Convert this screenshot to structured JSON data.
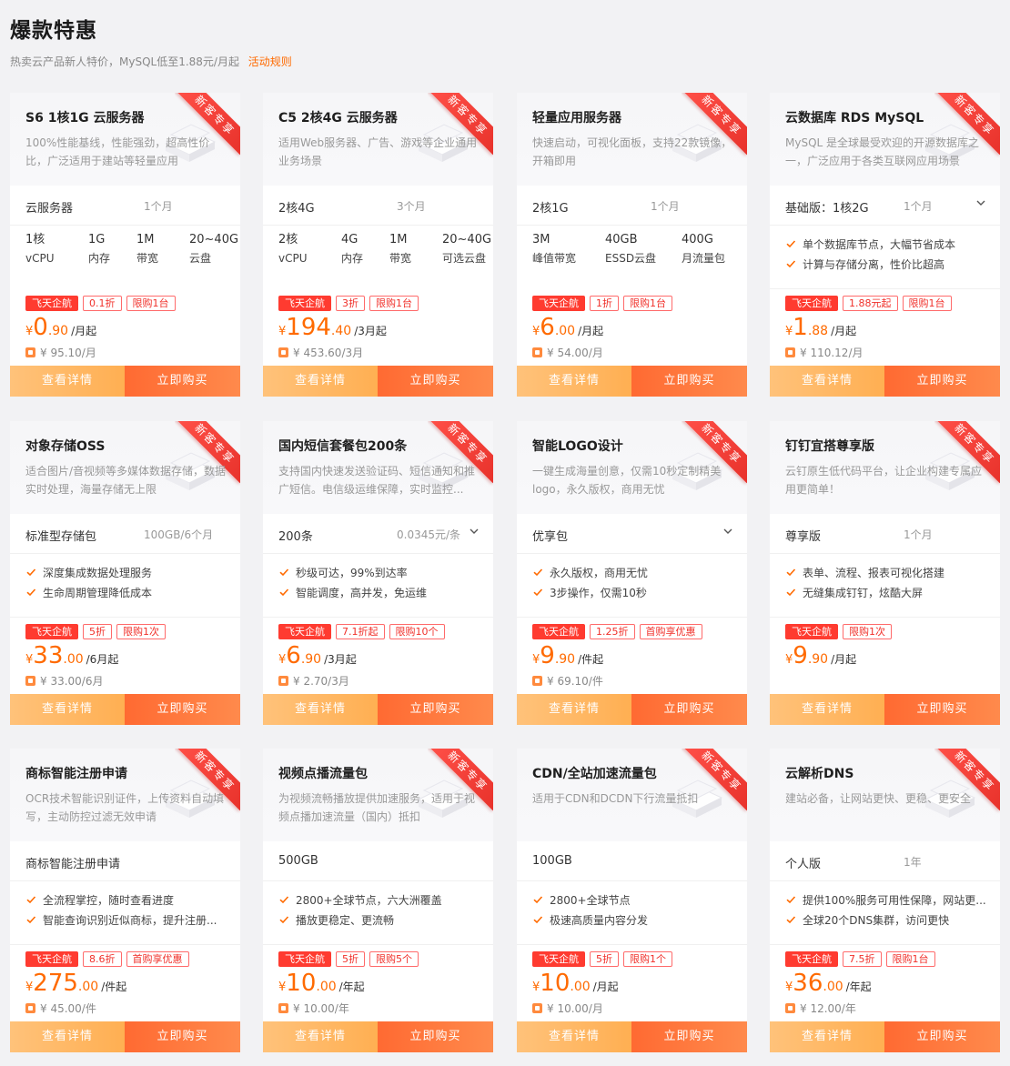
{
  "page": {
    "title": "爆款特惠",
    "subtitle": "热卖云产品新人特价，MySQL低至1.88元/月起",
    "rule_link": "活动规则"
  },
  "common": {
    "ribbon": "新客专享",
    "detail_btn": "查看详情",
    "buy_btn": "立即购买",
    "promo_tag": "飞天企航"
  },
  "cards": [
    {
      "title": "S6 1核1G 云服务器",
      "desc": "100%性能基线，性能强劲，超高性价比，广泛适用于建站等轻量应用",
      "spec": "云服务器",
      "duration": "1个月",
      "has_dropdown": false,
      "params": [
        {
          "v": "1核",
          "l": "vCPU"
        },
        {
          "v": "1G",
          "l": "内存"
        },
        {
          "v": "1M",
          "l": "带宽"
        },
        {
          "v": "20~40G",
          "l": "云盘"
        }
      ],
      "features": [],
      "tags": [
        "0.1折",
        "限购1台"
      ],
      "price_cur": "¥",
      "price_int": "0",
      "price_dec": ".90",
      "price_unit": "/月起",
      "orig": "¥ 95.10/月"
    },
    {
      "title": "C5 2核4G 云服务器",
      "desc": "适用Web服务器、广告、游戏等企业通用业务场景",
      "spec": "2核4G",
      "duration": "3个月",
      "has_dropdown": false,
      "params": [
        {
          "v": "2核",
          "l": "vCPU"
        },
        {
          "v": "4G",
          "l": "内存"
        },
        {
          "v": "1M",
          "l": "带宽"
        },
        {
          "v": "20~40G",
          "l": "可选云盘"
        }
      ],
      "features": [],
      "tags": [
        "3折",
        "限购1台"
      ],
      "price_cur": "¥",
      "price_int": "194",
      "price_dec": ".40",
      "price_unit": "/3月起",
      "orig": "¥ 453.60/3月"
    },
    {
      "title": "轻量应用服务器",
      "desc": "快速启动，可视化面板，支持22款镜像，开箱即用",
      "spec": "2核1G",
      "duration": "1个月",
      "has_dropdown": false,
      "params": [
        {
          "v": "3M",
          "l": "峰值带宽"
        },
        {
          "v": "40GB",
          "l": "ESSD云盘"
        },
        {
          "v": "400G",
          "l": "月流量包"
        }
      ],
      "features": [],
      "tags": [
        "1折",
        "限购1台"
      ],
      "price_cur": "¥",
      "price_int": "6",
      "price_dec": ".00",
      "price_unit": "/月起",
      "orig": "¥ 54.00/月"
    },
    {
      "title": "云数据库 RDS MySQL",
      "desc": "MySQL 是全球最受欢迎的开源数据库之一，广泛应用于各类互联网应用场景",
      "spec": "基础版：1核2G",
      "duration": "1个月",
      "has_dropdown": true,
      "params": [],
      "features": [
        "单个数据库节点，大幅节省成本",
        "计算与存储分离，性价比超高"
      ],
      "tags": [
        "1.88元起",
        "限购1台"
      ],
      "price_cur": "¥",
      "price_int": "1",
      "price_dec": ".88",
      "price_unit": "/月起",
      "orig": "¥ 110.12/月"
    },
    {
      "title": "对象存储OSS",
      "desc": "适合图片/音视频等多媒体数据存储，数据实时处理，海量存储无上限",
      "spec": "标准型存储包",
      "duration": "100GB/6个月",
      "has_dropdown": false,
      "params": [],
      "features": [
        "深度集成数据处理服务",
        "生命周期管理降低成本"
      ],
      "tags": [
        "5折",
        "限购1次"
      ],
      "price_cur": "¥",
      "price_int": "33",
      "price_dec": ".00",
      "price_unit": "/6月起",
      "orig": "¥ 33.00/6月"
    },
    {
      "title": "国内短信套餐包200条",
      "desc": "支持国内快速发送验证码、短信通知和推广短信。电信级运维保障，实时监控...",
      "spec": "200条",
      "duration": "0.0345元/条",
      "has_dropdown": true,
      "params": [],
      "features": [
        "秒级可达，99%到达率",
        "智能调度，高并发，免运维"
      ],
      "tags": [
        "7.1折起",
        "限购10个"
      ],
      "price_cur": "¥",
      "price_int": "6",
      "price_dec": ".90",
      "price_unit": "/3月起",
      "orig": "¥ 2.70/3月"
    },
    {
      "title": "智能LOGO设计",
      "desc": "一键生成海量创意，仅需10秒定制精美logo，永久版权，商用无忧",
      "spec": "优享包",
      "duration": "",
      "has_dropdown": true,
      "params": [],
      "features": [
        "永久版权，商用无忧",
        "3步操作，仅需10秒"
      ],
      "tags": [
        "1.25折",
        "首购享优惠"
      ],
      "price_cur": "¥",
      "price_int": "9",
      "price_dec": ".90",
      "price_unit": "/件起",
      "orig": "¥ 69.10/件"
    },
    {
      "title": "钉钉宜搭尊享版",
      "desc": "云钉原生低代码平台，让企业构建专属应用更简单！",
      "spec": "尊享版",
      "duration": "1个月",
      "has_dropdown": false,
      "params": [],
      "features": [
        "表单、流程、报表可视化搭建",
        "无缝集成钉钉，炫酷大屏"
      ],
      "tags": [
        "限购1次"
      ],
      "price_cur": "¥",
      "price_int": "9",
      "price_dec": ".90",
      "price_unit": "/月起",
      "orig": ""
    },
    {
      "title": "商标智能注册申请",
      "desc": "OCR技术智能识别证件，上传资料自动填写，主动防控过滤无效申请",
      "spec": "商标智能注册申请",
      "duration": "",
      "has_dropdown": false,
      "params": [],
      "features": [
        "全流程掌控，随时查看进度",
        "智能查询识别近似商标，提升注册..."
      ],
      "tags": [
        "8.6折",
        "首购享优惠"
      ],
      "price_cur": "¥",
      "price_int": "275",
      "price_dec": ".00",
      "price_unit": "/件起",
      "orig": "¥ 45.00/件"
    },
    {
      "title": "视频点播流量包",
      "desc": "为视频流畅播放提供加速服务，适用于视频点播加速流量（国内）抵扣",
      "spec": "500GB",
      "duration": "",
      "has_dropdown": false,
      "params": [],
      "features": [
        "2800+全球节点，六大洲覆盖",
        "播放更稳定、更流畅"
      ],
      "tags": [
        "5折",
        "限购5个"
      ],
      "price_cur": "¥",
      "price_int": "10",
      "price_dec": ".00",
      "price_unit": "/年起",
      "orig": "¥ 10.00/年"
    },
    {
      "title": "CDN/全站加速流量包",
      "desc": "适用于CDN和DCDN下行流量抵扣",
      "spec": "100GB",
      "duration": "",
      "has_dropdown": false,
      "params": [],
      "features": [
        "2800+全球节点",
        "极速高质量内容分发"
      ],
      "tags": [
        "5折",
        "限购1个"
      ],
      "price_cur": "¥",
      "price_int": "10",
      "price_dec": ".00",
      "price_unit": "/月起",
      "orig": "¥ 10.00/月"
    },
    {
      "title": "云解析DNS",
      "desc": "建站必备，让网站更快、更稳、更安全",
      "spec": "个人版",
      "duration": "1年",
      "has_dropdown": false,
      "params": [],
      "features": [
        "提供100%服务可用性保障，网站更...",
        "全球20个DNS集群，访问更快"
      ],
      "tags": [
        "7.5折",
        "限购1台"
      ],
      "price_cur": "¥",
      "price_int": "36",
      "price_dec": ".00",
      "price_unit": "/年起",
      "orig": "¥ 12.00/年"
    }
  ]
}
